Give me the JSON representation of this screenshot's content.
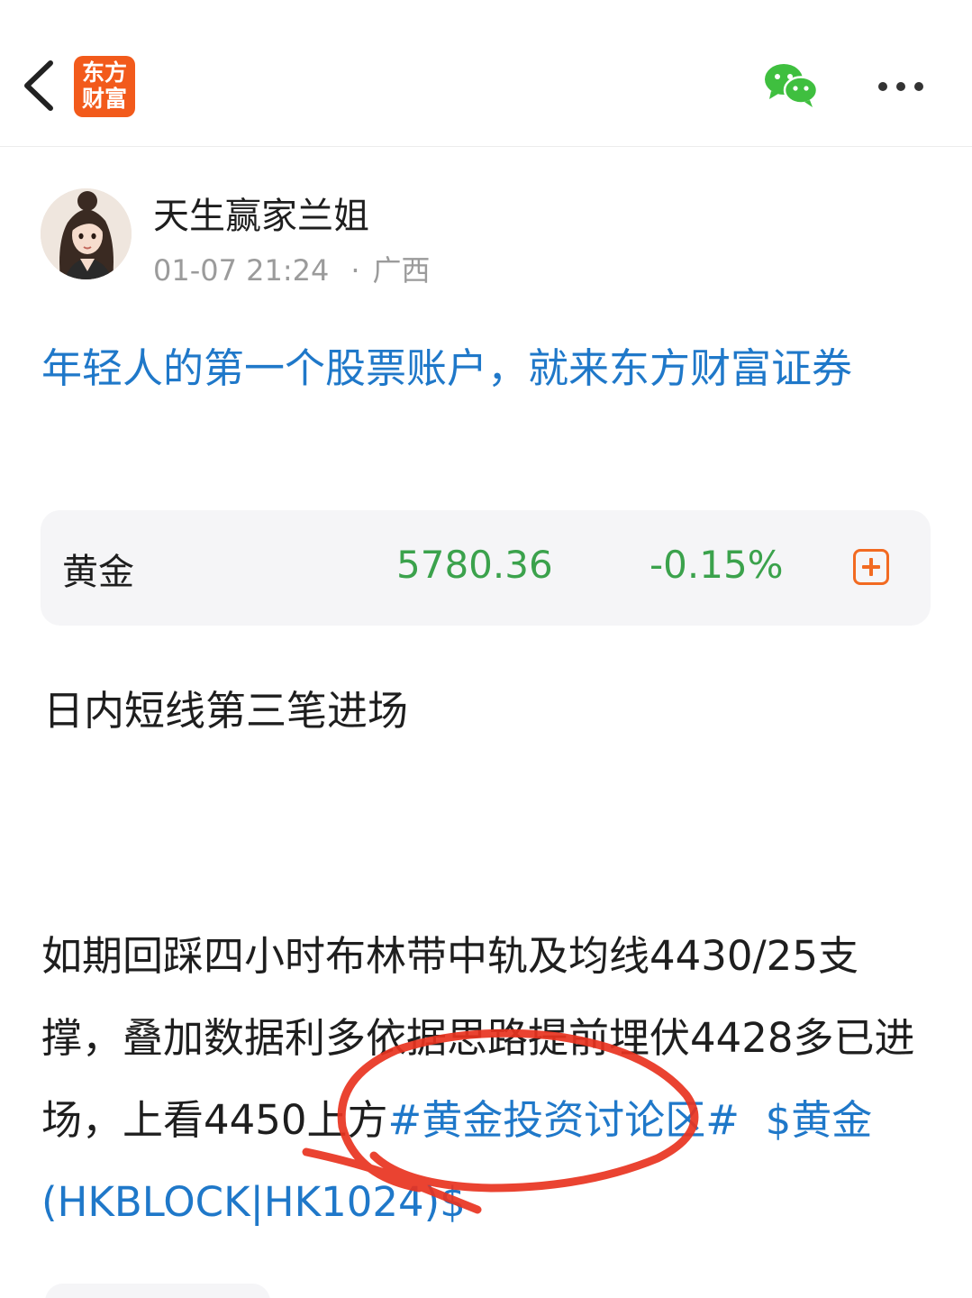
{
  "header": {
    "logo_line1": "东方",
    "logo_line2": "财富",
    "brand_color": "#f25a1b"
  },
  "author": {
    "name": "天生赢家兰姐",
    "time": "01-07 21:24",
    "separator": "·",
    "location": "广西"
  },
  "promo": {
    "text": "年轻人的第一个股票账户，就来东方财富证券",
    "color": "#1f78c9"
  },
  "quote": {
    "name": "黄金",
    "price": "5780.36",
    "change": "-0.15%",
    "color": "#3ba24c"
  },
  "post": {
    "heading": "日内短线第三笔进场",
    "body": "如期回踩四小时布林带中轨及均线4430/25支撑，叠加数据利多依据思路提前埋伏4428多已进场，上看4450上方",
    "topic_tag": "#黄金投资讨论区#",
    "stock_tag": "$黄金(HKBLOCK|HK1024)$"
  },
  "icons": {
    "back": "chevron-left-icon",
    "share_wechat": "wechat-icon",
    "more": "more-horizontal-icon",
    "add": "plus-square-icon"
  }
}
